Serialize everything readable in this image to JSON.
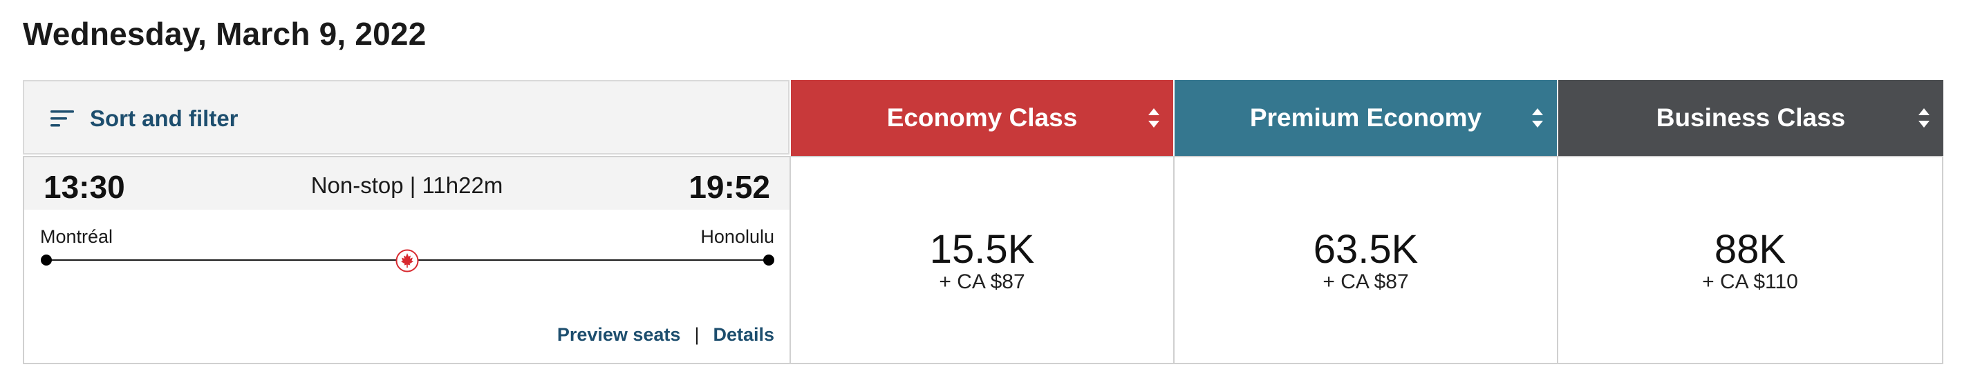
{
  "page": {
    "title": "Wednesday, March 9, 2022"
  },
  "filter": {
    "label": "Sort and filter",
    "icon": "sort-filter-icon"
  },
  "cabins": [
    {
      "label": "Economy Class",
      "color": "#c8393a",
      "icon": "sort-arrows-icon"
    },
    {
      "label": "Premium Economy",
      "color": "#35778f",
      "icon": "sort-arrows-icon"
    },
    {
      "label": "Business Class",
      "color": "#4b4d50",
      "icon": "sort-arrows-icon"
    }
  ],
  "flight": {
    "departure_time": "13:30",
    "arrival_time": "19:52",
    "stops_duration": "Non-stop | 11h22m",
    "origin": "Montréal",
    "destination": "Honolulu",
    "airline_icon": "maple-leaf-icon",
    "links": {
      "preview_seats": "Preview seats",
      "separator": "|",
      "details": "Details"
    }
  },
  "fares": [
    {
      "points": "15.5K",
      "cash": "+ CA $87"
    },
    {
      "points": "63.5K",
      "cash": "+ CA $87"
    },
    {
      "points": "88K",
      "cash": "+ CA $110"
    }
  ]
}
